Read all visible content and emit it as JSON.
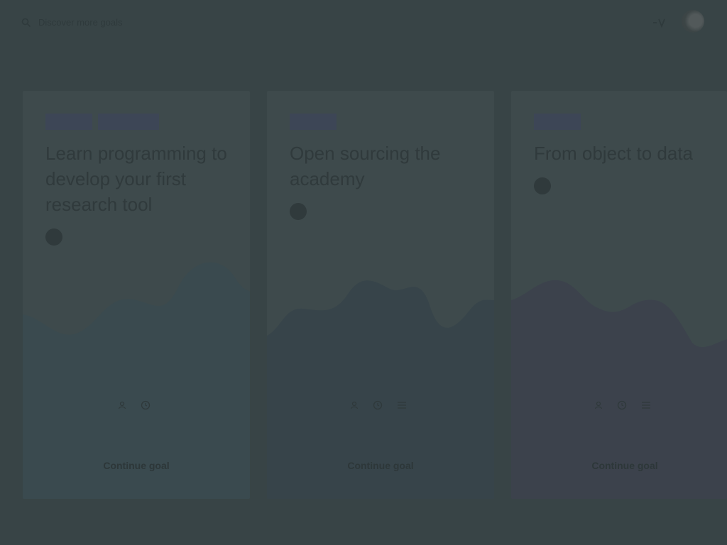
{
  "header": {
    "search_placeholder": "Discover more goals",
    "icons": {
      "search": "search-icon",
      "logo": "brand-logo-icon",
      "avatar": "user-avatar"
    }
  },
  "colors": {
    "background": "#384446",
    "card": "#3e4a4c",
    "tag": "#3d4656"
  },
  "cards": [
    {
      "tags": [
        "",
        ""
      ],
      "title": "Learn programming to develop your first research tool",
      "author": "",
      "stats": [
        "",
        ""
      ],
      "cta": "Continue goal",
      "wave_color": "#3a4a4f"
    },
    {
      "tags": [
        ""
      ],
      "title": "Open sourcing the academy",
      "author": "",
      "stats": [
        "",
        "",
        ""
      ],
      "cta": "Continue goal",
      "wave_color": "#37444a"
    },
    {
      "tags": [
        ""
      ],
      "title": "From object to data",
      "author": "",
      "stats": [
        "",
        "",
        ""
      ],
      "cta": "Continue goal",
      "wave_color": "#3c424c"
    }
  ]
}
